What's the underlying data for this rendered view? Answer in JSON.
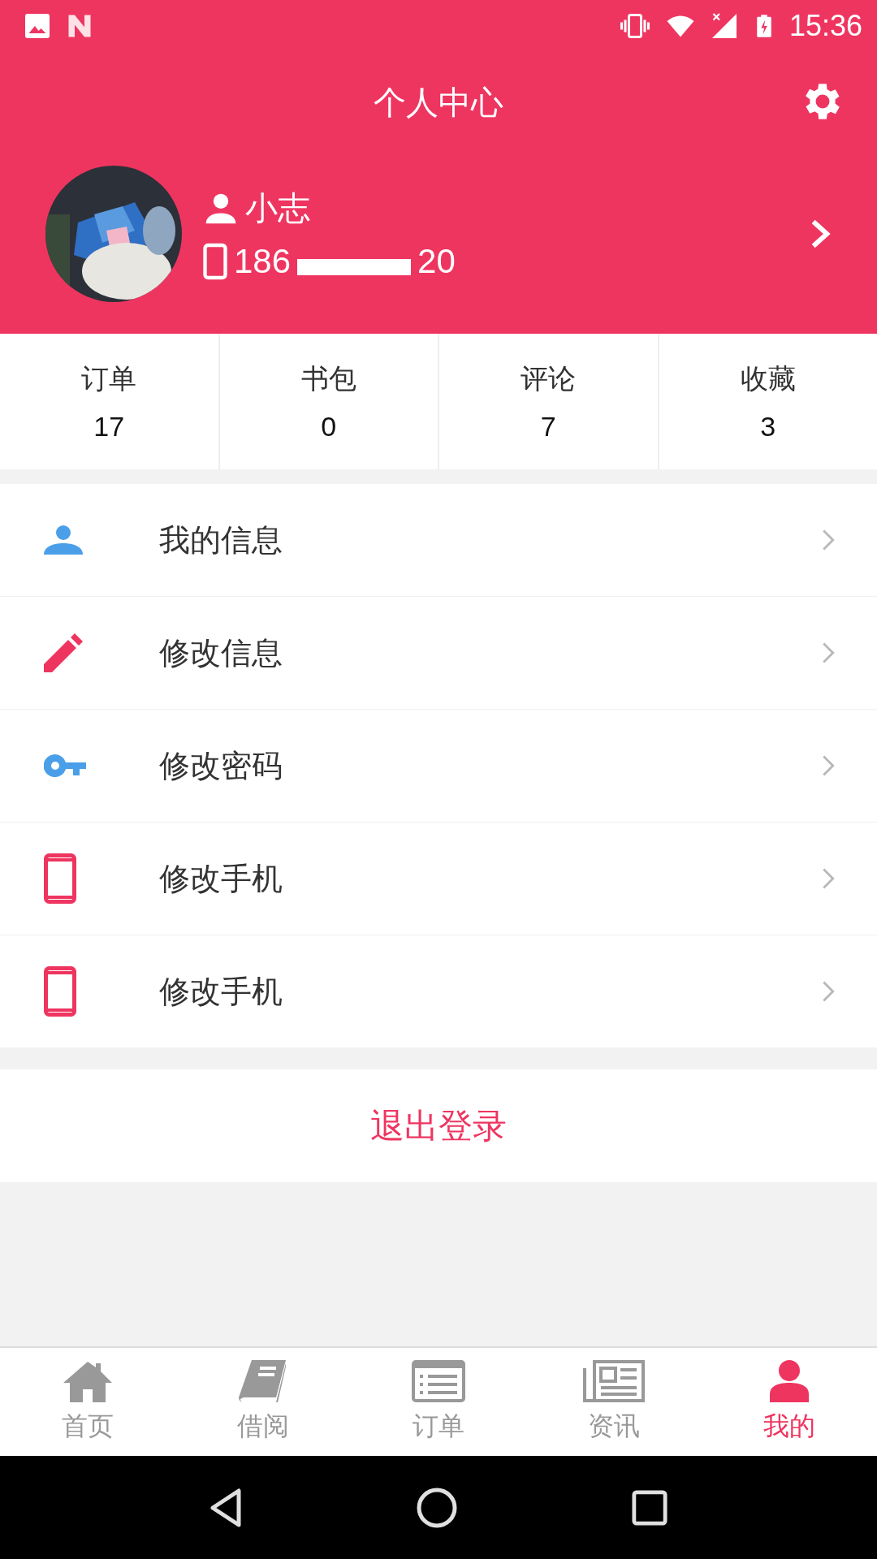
{
  "status_bar": {
    "time": "15:36"
  },
  "header": {
    "title": "个人中心"
  },
  "profile": {
    "name": "小志",
    "phone_prefix": "186",
    "phone_suffix": "20"
  },
  "stats": [
    {
      "label": "订单",
      "value": "17"
    },
    {
      "label": "书包",
      "value": "0"
    },
    {
      "label": "评论",
      "value": "7"
    },
    {
      "label": "收藏",
      "value": "3"
    }
  ],
  "menu": [
    {
      "kind": "person",
      "color": "#4a9fe8",
      "label": "我的信息"
    },
    {
      "kind": "pencil",
      "color": "#ee3560",
      "label": "修改信息"
    },
    {
      "kind": "key",
      "color": "#4a9fe8",
      "label": "修改密码"
    },
    {
      "kind": "phone",
      "color": "#ee3560",
      "label": "修改手机"
    },
    {
      "kind": "phone",
      "color": "#ee3560",
      "label": "修改手机"
    }
  ],
  "logout": {
    "label": "退出登录"
  },
  "tabs": [
    {
      "kind": "home",
      "label": "首页",
      "selected": false
    },
    {
      "kind": "book",
      "label": "借阅",
      "selected": false
    },
    {
      "kind": "list",
      "label": "订单",
      "selected": false
    },
    {
      "kind": "news",
      "label": "资讯",
      "selected": false
    },
    {
      "kind": "user",
      "label": "我的",
      "selected": true
    }
  ]
}
